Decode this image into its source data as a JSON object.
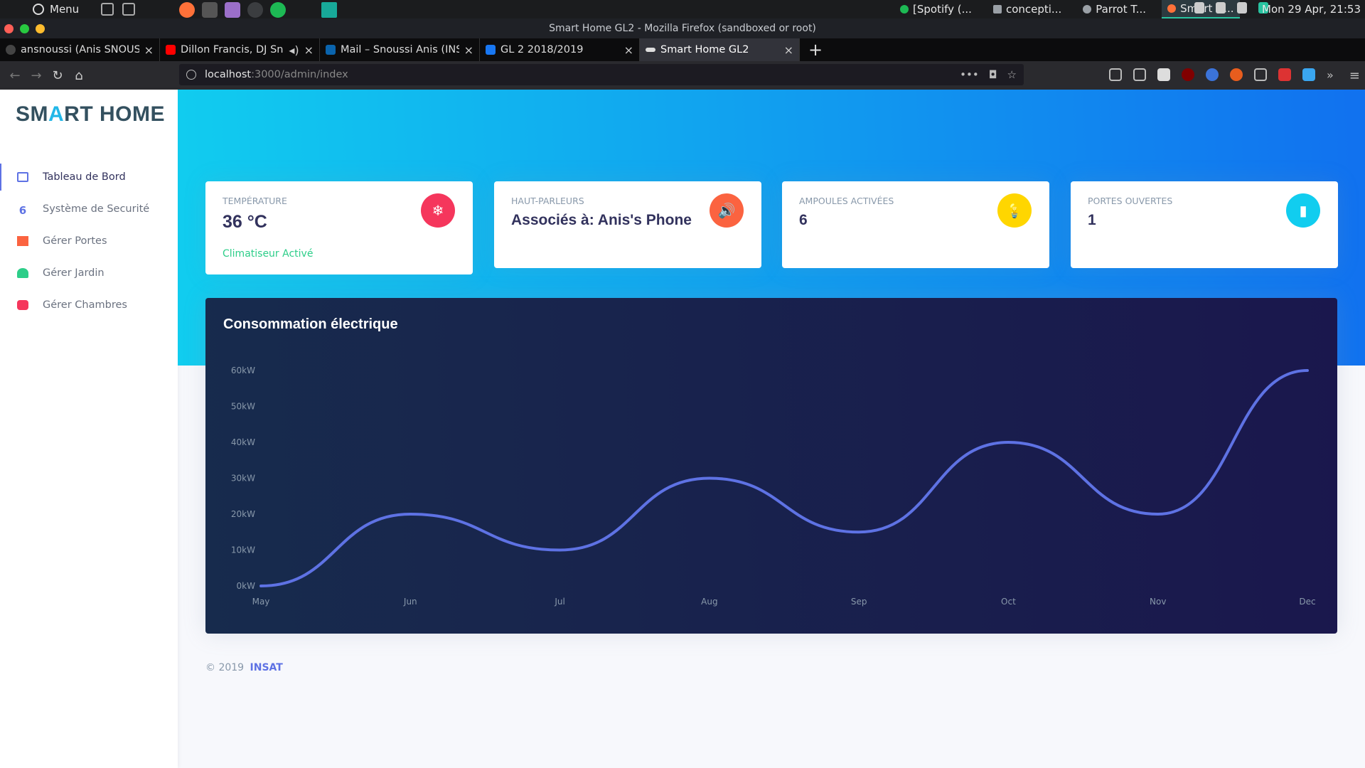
{
  "os_panel": {
    "menu_label": "Menu",
    "tasks": [
      {
        "label": "[Spotify (...",
        "color": "#1db954"
      },
      {
        "label": "concepti...",
        "color": "#9aa0a6"
      },
      {
        "label": "Parrot T...",
        "color": "#9aa0a6"
      },
      {
        "label": "Smart H...",
        "color": "#ff7139"
      }
    ],
    "clock": "Mon 29 Apr, 21:53"
  },
  "window": {
    "title": "Smart Home GL2 - Mozilla Firefox (sandboxed or root)"
  },
  "tabs": [
    {
      "label": "ansnoussi (Anis SNOUSSI)",
      "favicon": "github-icon",
      "color": "#444"
    },
    {
      "label": "Dillon Francis, DJ Snake",
      "favicon": "youtube-icon",
      "color": "#ff0000",
      "audio": true
    },
    {
      "label": "Mail – Snoussi Anis (INSAT)",
      "favicon": "outlook-icon",
      "color": "#0a64ad"
    },
    {
      "label": "GL 2 2018/2019",
      "favicon": "facebook-icon",
      "color": "#1877f2"
    },
    {
      "label": "Smart Home GL2",
      "favicon": "mask-icon",
      "color": "#ddd",
      "active": true
    }
  ],
  "urlbar": {
    "host": "localhost",
    "path": ":3000/admin/index"
  },
  "sidebar": {
    "brand_pre": "SM",
    "brand_roof": "A",
    "brand_post": "RT HOME",
    "items": [
      {
        "label": "Tableau de Bord",
        "icon": "monitor-icon",
        "color": "#5e72e4",
        "active": true
      },
      {
        "label": "Système de Securité",
        "icon": "lock-icon",
        "color": "#5e72e4"
      },
      {
        "label": "Gérer Portes",
        "icon": "door-icon",
        "color": "#fb6340"
      },
      {
        "label": "Gérer Jardin",
        "icon": "plant-icon",
        "color": "#2dce89"
      },
      {
        "label": "Gérer Chambres",
        "icon": "sofa-icon",
        "color": "#f5365c"
      }
    ]
  },
  "cards": [
    {
      "title": "Température",
      "value": "36 °C",
      "footer": "Climatiseur Activé",
      "icon": "snowflake-icon",
      "color": "#f5365c"
    },
    {
      "title": "Haut-Parleurs",
      "value": "Associés à: Anis's Phone",
      "icon": "speaker-icon",
      "color": "#fb6340"
    },
    {
      "title": "Ampoules Activées",
      "value": "6",
      "icon": "lightbulb-icon",
      "color": "#ffd600"
    },
    {
      "title": "Portes Ouvertes",
      "value": "1",
      "icon": "door-open-icon",
      "color": "#11cdef"
    }
  ],
  "chart_data": {
    "type": "line",
    "title": "Consommation électrique",
    "categories": [
      "May",
      "Jun",
      "Jul",
      "Aug",
      "Sep",
      "Oct",
      "Nov",
      "Dec"
    ],
    "values": [
      0,
      20,
      10,
      30,
      15,
      40,
      20,
      60
    ],
    "y_ticks": [
      "0kW",
      "10kW",
      "20kW",
      "30kW",
      "40kW",
      "50kW",
      "60kW"
    ],
    "ylim": [
      0,
      60
    ],
    "grid": false,
    "line_color": "#5e72e4",
    "xlabel": "",
    "ylabel": ""
  },
  "footer": {
    "copyright": "© 2019",
    "link": "INSAT"
  }
}
